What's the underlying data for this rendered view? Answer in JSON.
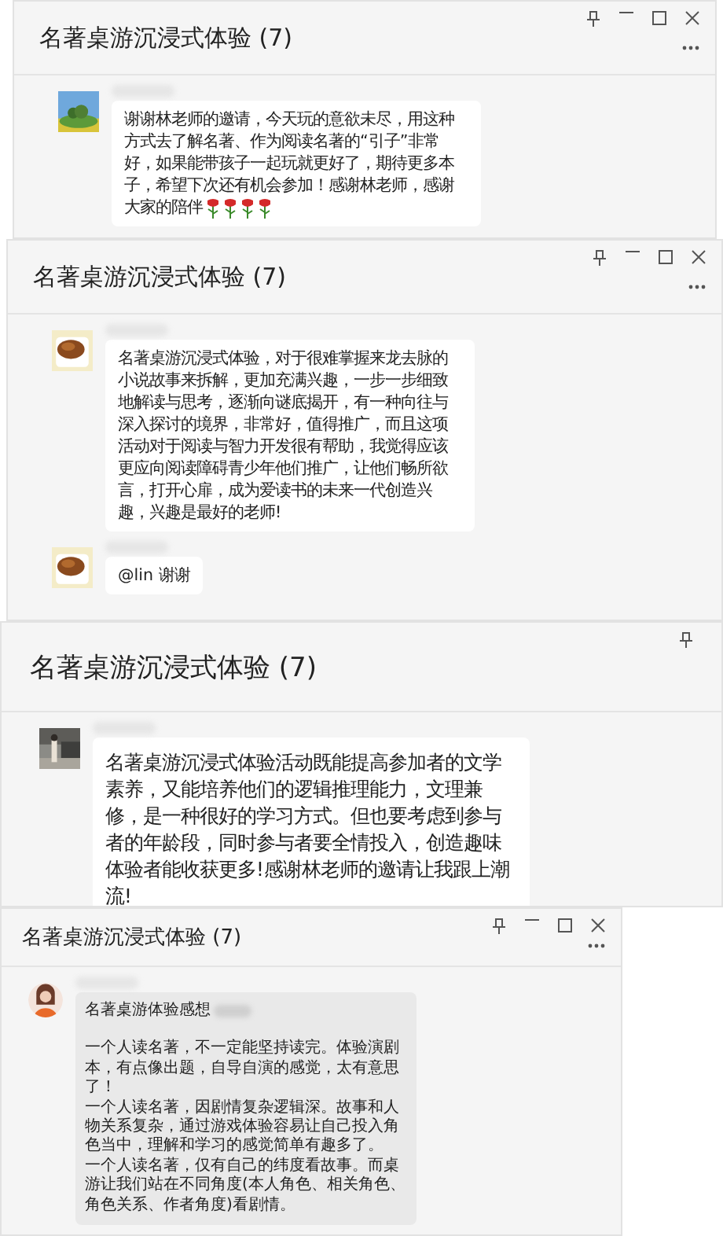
{
  "windows": [
    {
      "title": "名著桌游沉浸式体验 (7)",
      "kind": "standard",
      "controls": [
        {
          "kind": "pin"
        },
        {
          "kind": "minimize"
        },
        {
          "kind": "maximize"
        },
        {
          "kind": "close"
        },
        {
          "kind": "more"
        }
      ],
      "messages": [
        {
          "paragraphs": [
            "谢谢林老师的邀请，今天玩的意欲未尽，用这种方式去了解名著、作为阅读名著的“引子”非常好，如果能带孩子一起玩就更好了，期待更多本子，希望下次还有机会参加！感谢林老师，感谢"
          ],
          "last_line": "大家的陪伴",
          "trailing_icons": [
            {
              "kind": "rose"
            },
            {
              "kind": "rose"
            },
            {
              "kind": "rose"
            },
            {
              "kind": "rose"
            }
          ]
        }
      ]
    },
    {
      "title": "名著桌游沉浸式体验 (7)",
      "kind": "standard",
      "controls": [
        {
          "kind": "pin"
        },
        {
          "kind": "minimize"
        },
        {
          "kind": "maximize"
        },
        {
          "kind": "close"
        },
        {
          "kind": "more"
        }
      ],
      "messages": [
        {
          "paragraphs": [
            "名著桌游沉浸式体验，对于很难掌握来龙去脉的小说故事来拆解，更加充满兴趣，一步一步细致地解读与思考，逐渐向谜底揭开，有一种向往与深入探讨的境界，非常好，值得推广，而且这项活动对于阅读与智力开发很有帮助，我觉得应该更应向阅读障碍青少年他们推广，让他们畅所欲言，打开心扉，成为爱读书的未来一代创造兴趣，兴趣是最好的老师!"
          ]
        },
        {
          "paragraphs": [
            "@lin 谢谢"
          ]
        }
      ]
    },
    {
      "title": "名著桌游沉浸式体验 (7)",
      "kind": "large",
      "controls": [
        {
          "kind": "pin"
        }
      ],
      "messages": [
        {
          "paragraphs": [
            "名著桌游沉浸式体验活动既能提高参加者的文学素养，又能培养他们的逻辑推理能力，文理兼修，是一种很好的学习方式。但也要考虑到参与者的年龄段，同时参与者要全情投入，创造趣味体验者能收获更多!感谢林老师的邀请让我跟上潮流!"
          ]
        }
      ]
    },
    {
      "title": "名著桌游沉浸式体验 (7)",
      "kind": "compact",
      "controls": [
        {
          "kind": "pin"
        },
        {
          "kind": "minimize"
        },
        {
          "kind": "maximize"
        },
        {
          "kind": "close"
        },
        {
          "kind": "more"
        }
      ],
      "messages": [
        {
          "heading": "名著桌游体验感想",
          "paragraphs": [
            "一个人读名著，不一定能坚持读完。体验演剧本，有点像出题，自导自演的感觉，太有意思了！",
            "一个人读名著，因剧情复杂逻辑深。故事和人物关系复杂，通过游戏体验容易让自己投入角色当中，理解和学习的感觉简单有趣多了。",
            "一个人读名著，仅有自己的纬度看故事。而桌游让我们站在不同角度(本人角色、相关角色、角色关系、作者角度)看剧情。"
          ]
        }
      ]
    }
  ]
}
